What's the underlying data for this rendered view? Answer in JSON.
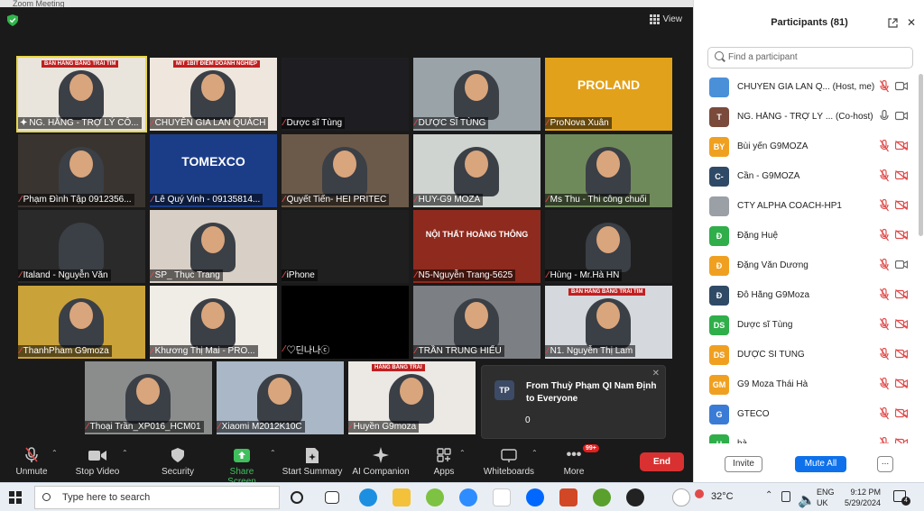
{
  "window": {
    "title": "Zoom Meeting"
  },
  "meeting": {
    "view_label": "View",
    "tiles": [
      {
        "name": "NG. HẰNG - TRỢ LÝ CÔ...",
        "banner": "BÁN HÀNG BẰNG TRÁI TIM",
        "bg": "#e9e4dc",
        "active": true,
        "mic": "pin"
      },
      {
        "name": "CHUYÊN GIA LAN QUÁCH",
        "banner": "MIT 1BIT ĐIỂM DOANH NGHIỆP",
        "bg": "#efe7dd",
        "mic": "off"
      },
      {
        "name": "Dược sĩ Tùng",
        "bg": "#1e1e22",
        "mic": "off"
      },
      {
        "name": "DƯỢC SĨ TÙNG",
        "bg": "#9aa3a8",
        "mic": "off"
      },
      {
        "name": "ProNova Xuân",
        "bg": "#e2a11a",
        "logo": "PROLAND",
        "mic": "off"
      },
      {
        "name": "Phạm Đình Tập 0912356...",
        "bg": "#3a3430",
        "mic": "off"
      },
      {
        "name": "Lê Quý Vinh - 09135814...",
        "bg": "#1b3d88",
        "logo": "TOMEXCO",
        "mic": "off"
      },
      {
        "name": "Quyết Tiến- HEI PRITEC",
        "bg": "#6b5a4a",
        "mic": "off"
      },
      {
        "name": "HUY-G9 MOZA",
        "bg": "#cfd4d0",
        "mic": "off"
      },
      {
        "name": "Ms Thu - Thi công chuối",
        "bg": "#6f8a5a",
        "mic": "off"
      },
      {
        "name": "Italand - Nguyễn Văn",
        "bg": "#2a2a2a",
        "mic": "off"
      },
      {
        "name": "SP_ Thục Trang",
        "bg": "#d8cfc6",
        "mic": "off"
      },
      {
        "name": "iPhone",
        "bg": "#1f1f1f",
        "mic": "off"
      },
      {
        "name": "N5-Nguyễn Trang-5625",
        "bg": "#8e2a1e",
        "logo": "NỘI THẤT HOÀNG THÔNG",
        "mic": "off"
      },
      {
        "name": "Hùng - Mr.Hà HN",
        "bg": "#202020",
        "mic": "off"
      },
      {
        "name": "ThanhPham G9moza",
        "bg": "#c9a23a",
        "mic": "off"
      },
      {
        "name": "Khương Thị Mai - PRO...",
        "bg": "#f0ece6",
        "mic": "off"
      },
      {
        "name": "♡딘나나ⓒ",
        "bg": "#000000",
        "mic": "off"
      },
      {
        "name": "TRẦN TRUNG HIẾU",
        "bg": "#7c7f84",
        "mic": "off"
      },
      {
        "name": "N1. Nguyễn Thị Lam",
        "bg": "#d5d8dd",
        "banner": "BÁN HÀNG BẰNG TRÁI TIM",
        "mic": "off"
      },
      {
        "name": "Thoại Trần_XP016_HCM01",
        "bg": "#8b8d8c",
        "mic": "off"
      },
      {
        "name": "Xiaomi M2012K10C",
        "bg": "#a9b7c6",
        "mic": "off"
      },
      {
        "name": "Huyền G9moza",
        "bg": "#ece8e3",
        "banner": "HÀNG BẰNG TRÁI",
        "mic": "off"
      }
    ]
  },
  "chat": {
    "avatar": "TP",
    "message": "From Thuỳ Phạm QI Nam Định to Everyone",
    "count": "0"
  },
  "toolbar": {
    "unmute": "Unmute",
    "stop_video": "Stop Video",
    "security": "Security",
    "share_screen": "Share Screen",
    "start_summary": "Start Summary",
    "ai_companion": "AI Companion",
    "apps": "Apps",
    "whiteboards": "Whiteboards",
    "more": "More",
    "more_badge": "99+",
    "end": "End"
  },
  "participants_panel": {
    "title": "Participants (81)",
    "search_placeholder": "Find a participant",
    "items": [
      {
        "initials": "",
        "color": "#4a90d9",
        "name": "CHUYÊN GIA LAN Q... (Host, me)",
        "mic": "off",
        "cam": "on"
      },
      {
        "initials": "T",
        "color": "#7a4a3a",
        "name": "NG. HẰNG - TRỢ LÝ ... (Co-host)",
        "mic": "on",
        "cam": "on"
      },
      {
        "initials": "BY",
        "color": "#f0a020",
        "name": "Bùi yến G9MOZA",
        "mic": "off",
        "cam": "off"
      },
      {
        "initials": "C-",
        "color": "#2f4a66",
        "name": "Cần - G9MOZA",
        "mic": "off",
        "cam": "off"
      },
      {
        "initials": "",
        "color": "#9aa0a6",
        "name": "CTY ALPHA COACH-HP1",
        "mic": "off",
        "cam": "off"
      },
      {
        "initials": "Đ",
        "color": "#2fae4a",
        "name": "Đặng Huệ",
        "mic": "off",
        "cam": "off"
      },
      {
        "initials": "Đ",
        "color": "#f0a020",
        "name": "Đặng Văn Dương",
        "mic": "off",
        "cam": "on"
      },
      {
        "initials": "Đ",
        "color": "#2f4a66",
        "name": "Đỗ Hằng G9Moza",
        "mic": "off",
        "cam": "off"
      },
      {
        "initials": "DS",
        "color": "#2fae4a",
        "name": "Dược sĩ Tùng",
        "mic": "off",
        "cam": "off"
      },
      {
        "initials": "DS",
        "color": "#f0a020",
        "name": "DƯỢC SĨ TÙNG",
        "mic": "off",
        "cam": "off"
      },
      {
        "initials": "GM",
        "color": "#f0a020",
        "name": "G9 Moza Thái Hà",
        "mic": "off",
        "cam": "off"
      },
      {
        "initials": "G",
        "color": "#3a7bd5",
        "name": "GTECO",
        "mic": "off",
        "cam": "off"
      },
      {
        "initials": "H",
        "color": "#2fae4a",
        "name": "hà",
        "mic": "off",
        "cam": "off"
      }
    ],
    "invite": "Invite",
    "mute_all": "Mute All",
    "more": "..."
  },
  "taskbar": {
    "search_placeholder": "Type here to search",
    "weather": "32°C",
    "lang_top": "ENG",
    "lang_bottom": "UK",
    "time": "9:12 PM",
    "date": "5/29/2024",
    "notifications": "4"
  },
  "colors": {
    "accent": "#0e71eb",
    "end": "#d93131",
    "share": "#3fc05c",
    "muted": "#e24a4a"
  }
}
